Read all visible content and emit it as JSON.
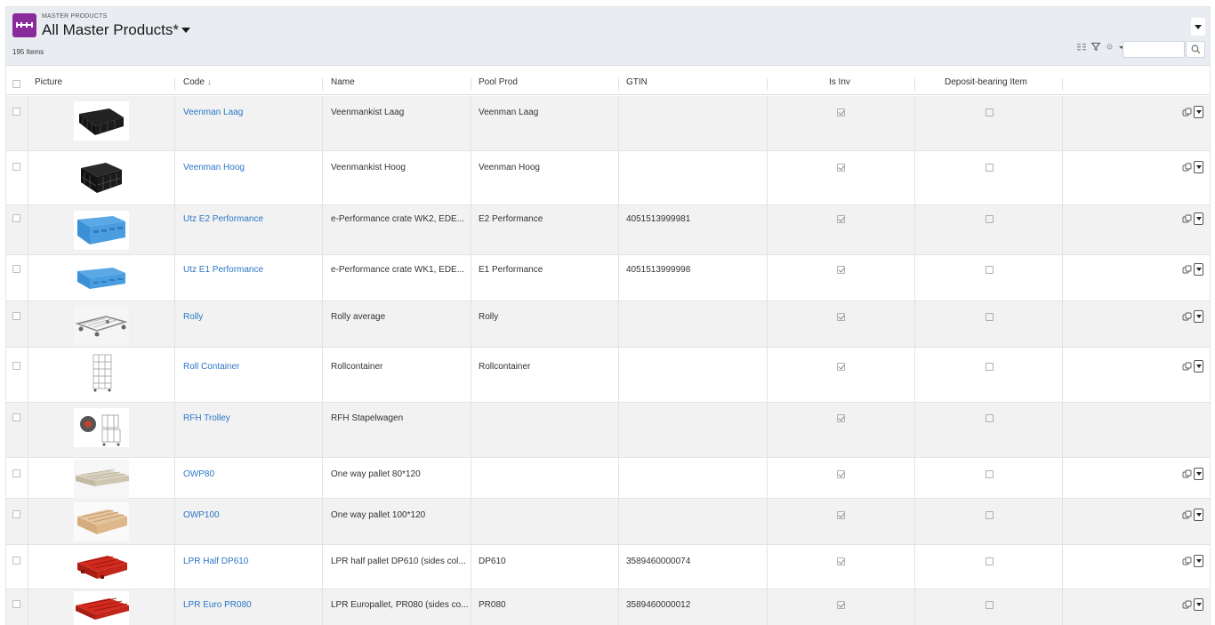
{
  "header": {
    "eyebrow": "MASTER PRODUCTS",
    "title": "All Master Products*",
    "items_count": "195 Items",
    "search_placeholder": ""
  },
  "columns": {
    "picture": "Picture",
    "code": "Code",
    "code_sort": "↓",
    "name": "Name",
    "pool_prod": "Pool Prod",
    "gtin": "GTIN",
    "is_inv": "Is Inv",
    "deposit": "Deposit-bearing Item"
  },
  "colors": {
    "app_icon": "#8b2a9a",
    "link": "#2a76c6",
    "header_bg": "#e9edf2"
  },
  "rows": [
    {
      "code": "Veenman Laag",
      "name": "Veenmankist Laag",
      "pool": "Veenman Laag",
      "gtin": "",
      "is_inv": true,
      "deposit": false,
      "actions": true,
      "picture": "black-crate-low"
    },
    {
      "code": "Veenman Hoog",
      "name": "Veenmankist Hoog",
      "pool": "Veenman Hoog",
      "gtin": "",
      "is_inv": true,
      "deposit": false,
      "actions": true,
      "picture": "black-crate-high"
    },
    {
      "code": "Utz E2 Performance",
      "name": "e-Performance crate WK2, EDE...",
      "pool": "E2 Performance",
      "gtin": "4051513999981",
      "is_inv": true,
      "deposit": false,
      "actions": true,
      "picture": "blue-crate"
    },
    {
      "code": "Utz E1 Performance",
      "name": "e-Performance crate WK1, EDE...",
      "pool": "E1 Performance",
      "gtin": "4051513999998",
      "is_inv": true,
      "deposit": false,
      "actions": true,
      "picture": "blue-crate-flat"
    },
    {
      "code": "Rolly",
      "name": "Rolly average",
      "pool": "Rolly",
      "gtin": "",
      "is_inv": true,
      "deposit": false,
      "actions": true,
      "picture": "dolly"
    },
    {
      "code": "Roll Container",
      "name": "Rollcontainer",
      "pool": "Rollcontainer",
      "gtin": "",
      "is_inv": true,
      "deposit": false,
      "actions": true,
      "picture": "roll-container"
    },
    {
      "code": "RFH Trolley",
      "name": "RFH Stapelwagen",
      "pool": "",
      "gtin": "",
      "is_inv": true,
      "deposit": false,
      "actions": false,
      "picture": "trolley"
    },
    {
      "code": "OWP80",
      "name": "One way pallet 80*120",
      "pool": "",
      "gtin": "",
      "is_inv": true,
      "deposit": false,
      "actions": true,
      "picture": "pallet-light"
    },
    {
      "code": "OWP100",
      "name": "One way pallet 100*120",
      "pool": "",
      "gtin": "",
      "is_inv": true,
      "deposit": false,
      "actions": true,
      "picture": "pallet-wood"
    },
    {
      "code": "LPR Half DP610",
      "name": "LPR half pallet DP610 (sides col...",
      "pool": "DP610",
      "gtin": "3589460000074",
      "is_inv": true,
      "deposit": false,
      "actions": true,
      "picture": "red-pallet-half"
    },
    {
      "code": "LPR Euro PR080",
      "name": "LPR Europallet, PR080 (sides co...",
      "pool": "PR080",
      "gtin": "3589460000012",
      "is_inv": true,
      "deposit": false,
      "actions": true,
      "picture": "red-pallet-euro"
    }
  ]
}
